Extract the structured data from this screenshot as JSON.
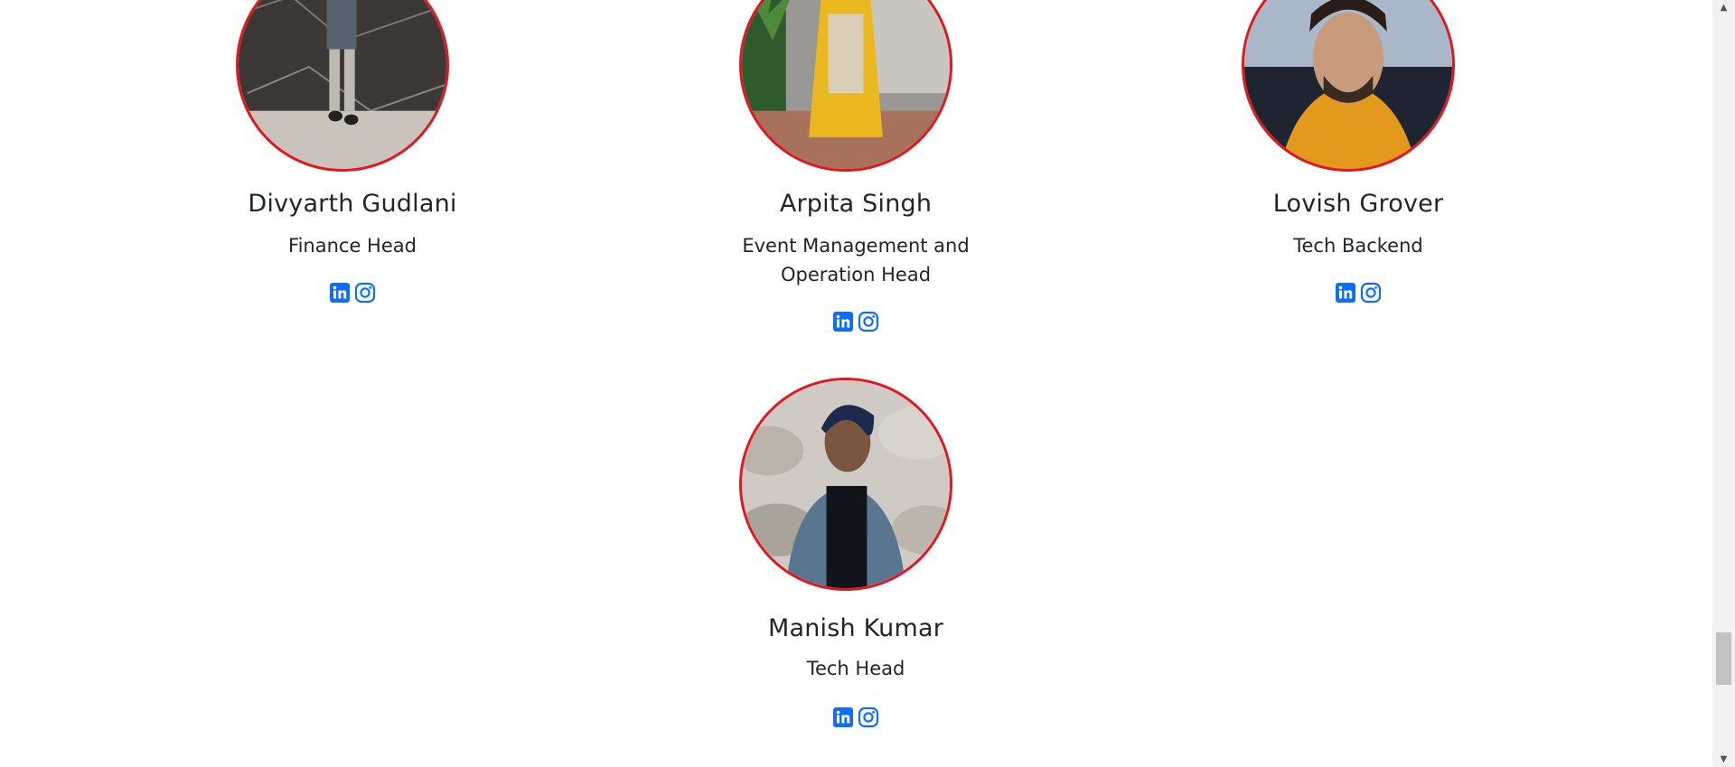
{
  "members": [
    {
      "name": "Divyarth Gudlani",
      "role": "Finance Head",
      "photo_alt": "Divyarth Gudlani photo",
      "icons": [
        "linkedin-icon",
        "instagram-icon"
      ]
    },
    {
      "name": "Arpita Singh",
      "role": "Event Management and Operation Head",
      "photo_alt": "Arpita Singh photo",
      "icons": [
        "linkedin-icon",
        "instagram-icon"
      ]
    },
    {
      "name": "Lovish Grover",
      "role": "Tech Backend",
      "photo_alt": "Lovish Grover photo",
      "icons": [
        "linkedin-icon",
        "instagram-icon"
      ]
    },
    {
      "name": "Manish Kumar",
      "role": "Tech Head",
      "photo_alt": "Manish Kumar photo",
      "icons": [
        "linkedin-icon",
        "instagram-icon"
      ]
    }
  ],
  "colors": {
    "accent_border": "#e3161f",
    "social_icon": "#0d6efd",
    "text": "#212529"
  },
  "scrollbar": {
    "up_glyph": "▲",
    "down_glyph": "▼"
  }
}
